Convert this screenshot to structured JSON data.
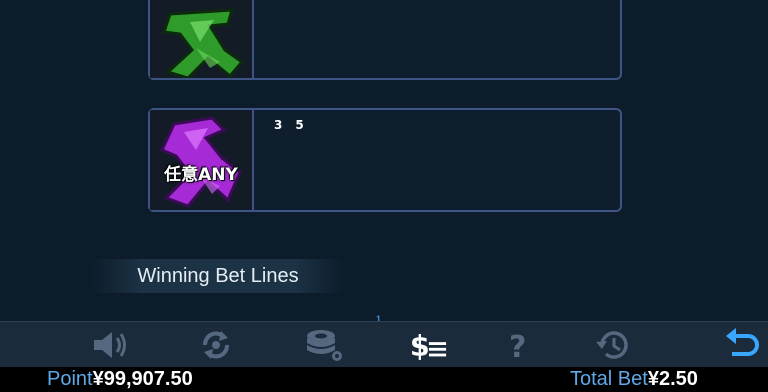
{
  "paytable": {
    "top_row": {
      "symbol": "green-fa-symbol",
      "values": []
    },
    "any_row": {
      "symbol": "purple-fa-symbol",
      "badge": "任意ANY",
      "values": [
        "3",
        "5"
      ]
    }
  },
  "section": {
    "title": "Winning Bet Lines",
    "page_marker": "1"
  },
  "toolbar": {
    "icons": [
      "speaker-icon",
      "autoplay-icon",
      "chips-icon",
      "paytable-icon",
      "help-icon",
      "history-icon",
      "back-icon"
    ],
    "colors": {
      "icon": "#55687f",
      "active": "#ffffff",
      "back": "#3aa7ff"
    }
  },
  "status": {
    "point_label": "Point",
    "point_value": "¥99,907.50",
    "bet_label": "Total Bet",
    "bet_value": "¥2.50"
  }
}
